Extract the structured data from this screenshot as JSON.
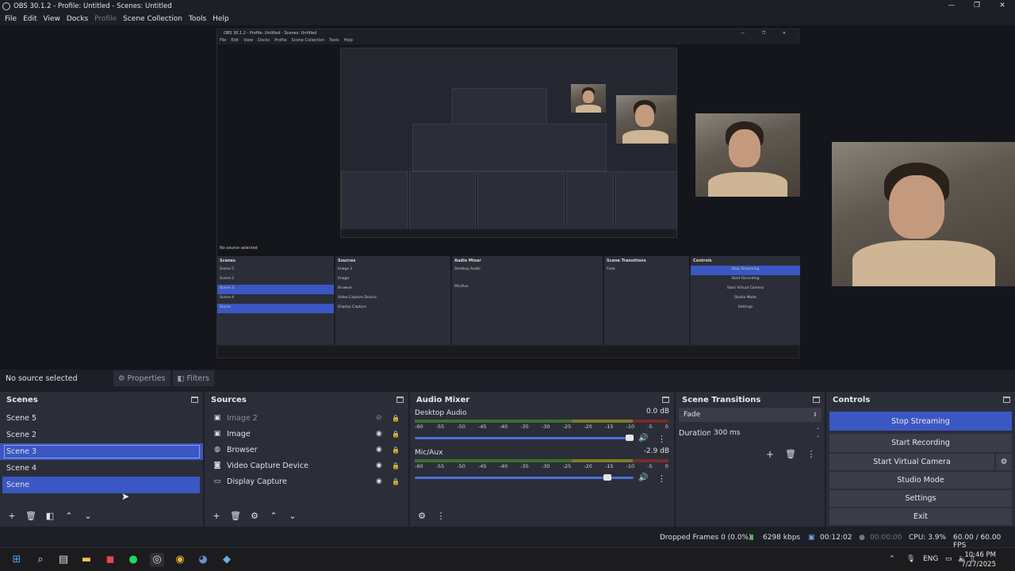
{
  "window": {
    "title": "OBS 30.1.2 - Profile: Untitled - Scenes: Untitled",
    "minimize": "—",
    "maximize": "❐",
    "close": "✕"
  },
  "menu": [
    "File",
    "Edit",
    "View",
    "Docks",
    "Profile",
    "Scene Collection",
    "Tools",
    "Help"
  ],
  "preview": {
    "nested_title": "OBS 30.1.2 - Profile: Untitled - Scenes: Untitled",
    "nested_menu": [
      "File",
      "Edit",
      "View",
      "Docks",
      "Profile",
      "Scene Collection",
      "Tools",
      "Help"
    ],
    "nested_source_bar": "No source selected",
    "nested_scenes_header": "Scenes",
    "nested_sources_header": "Sources",
    "nested_mixer_header": "Audio Mixer",
    "nested_transitions_header": "Scene Transitions",
    "nested_controls_header": "Controls"
  },
  "source_bar": {
    "status": "No source selected",
    "properties": "Properties",
    "filters": "Filters"
  },
  "scenes": {
    "header": "Scenes",
    "items": [
      "Scene 5",
      "Scene 2",
      "Scene 3",
      "Scene 4",
      "Scene"
    ]
  },
  "sources": {
    "header": "Sources",
    "items": [
      {
        "label": "Image 2",
        "icon": "image-icon",
        "hidden": true
      },
      {
        "label": "Image",
        "icon": "image-icon",
        "hidden": false
      },
      {
        "label": "Browser",
        "icon": "globe-icon",
        "hidden": false
      },
      {
        "label": "Video Capture Device",
        "icon": "camera-icon",
        "hidden": false
      },
      {
        "label": "Display Capture",
        "icon": "monitor-icon",
        "hidden": false
      }
    ]
  },
  "mixer": {
    "header": "Audio Mixer",
    "scale": [
      "-60",
      "-55",
      "-50",
      "-45",
      "-40",
      "-35",
      "-30",
      "-25",
      "-20",
      "-15",
      "-10",
      "-5",
      "0"
    ],
    "tracks": [
      {
        "name": "Desktop Audio",
        "db": "0.0 dB",
        "volume": 1.0
      },
      {
        "name": "Mic/Aux",
        "db": "-2.9 dB",
        "volume": 0.9
      }
    ]
  },
  "transitions": {
    "header": "Scene Transitions",
    "type": "Fade",
    "duration_label": "Duration",
    "duration_value": "300 ms"
  },
  "controls": {
    "header": "Controls",
    "buttons": [
      "Stop Streaming",
      "Start Recording",
      "Start Virtual Camera",
      "Studio Mode",
      "Settings",
      "Exit"
    ]
  },
  "status": {
    "dropped": "Dropped Frames 0 (0.0%)",
    "bitrate": "6298 kbps",
    "stream_time": "00:12:02",
    "rec_time": "00:00:00",
    "cpu": "CPU: 3.9%",
    "fps": "60.00 / 60.00 FPS"
  },
  "taskbar": {
    "lang": "ENG",
    "time": "10:46 PM",
    "date": "7/27/2025"
  },
  "colors": {
    "accent": "#3b57c3",
    "panel": "#2b2e38",
    "background": "#1d1f26"
  }
}
